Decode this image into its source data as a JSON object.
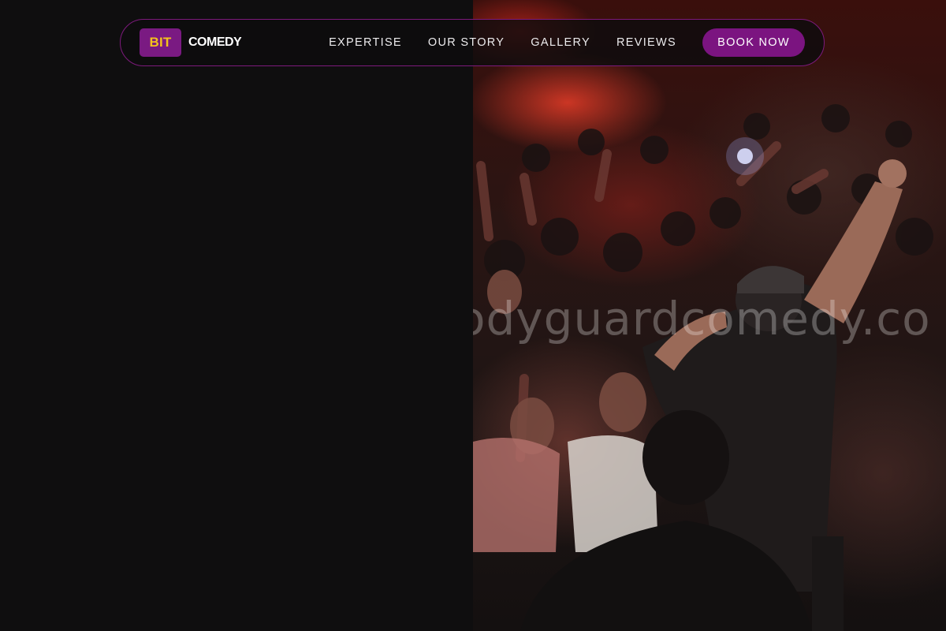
{
  "brand": {
    "logo_badge": "BIT",
    "logo_text": "COMEDY",
    "accent_color": "#7a1a82",
    "badge_text_color": "#f3c21c"
  },
  "nav": {
    "links": [
      "EXPERTISE",
      "OUR STORY",
      "GALLERY",
      "REVIEWS"
    ],
    "cta_label": "BOOK NOW"
  },
  "hero": {
    "image_subject": "performer-on-stage-crowd-photo",
    "watermark": "odyguardcomedy.co"
  }
}
